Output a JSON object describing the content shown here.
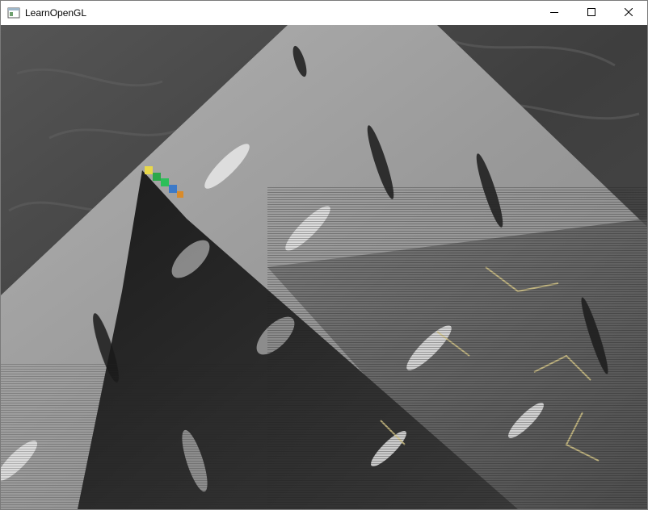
{
  "window": {
    "title": "LearnOpenGL",
    "icon": "opengl-app-icon"
  },
  "controls": {
    "minimize_icon": "minimize-icon",
    "maximize_icon": "maximize-icon",
    "close_icon": "close-icon"
  },
  "scene": {
    "description_icon": "rendered-3d-viewport",
    "colors": {
      "stone": "#4a4a4a",
      "metal_plate": "#9e9e9e",
      "shadow_plate": "#2c2c2c",
      "gold_vein": "#d8c98a"
    }
  }
}
